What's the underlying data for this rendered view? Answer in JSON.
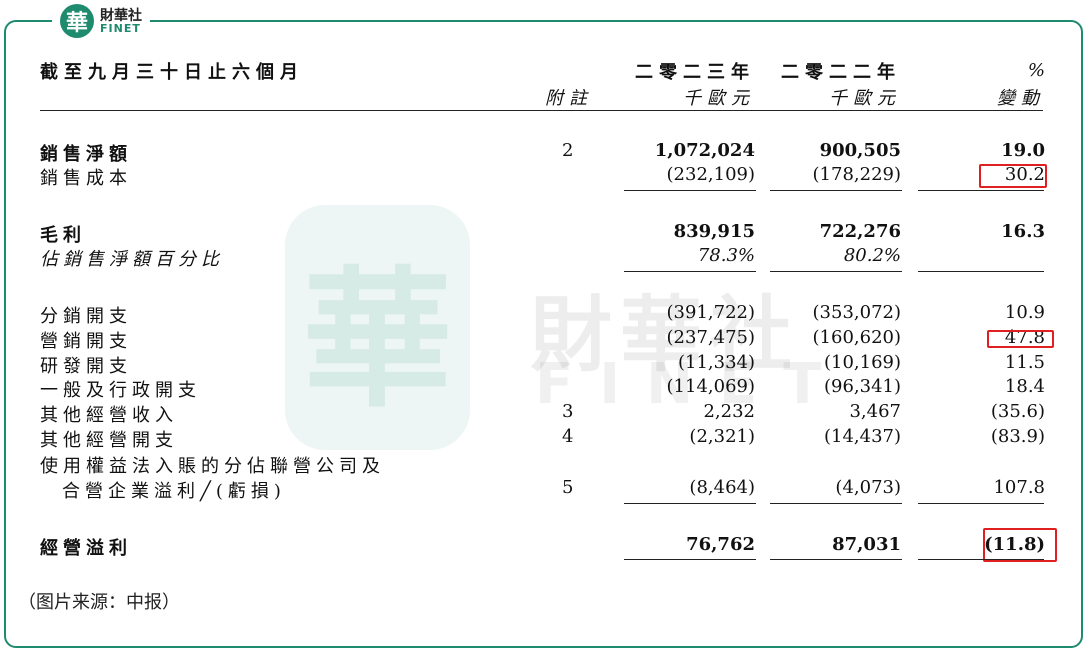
{
  "brand": {
    "logo_char": "華",
    "name_cn": "財華社",
    "name_en": "FINET"
  },
  "watermark": {
    "seal_char": "華",
    "text_cn": "財華社",
    "text_en": "FINET"
  },
  "header": {
    "period": "截至九月三十日止六個月",
    "note_col": "附註",
    "col_2023_year": "二零二三年",
    "col_2023_unit": "千歐元",
    "col_2022_year": "二零二二年",
    "col_2022_unit": "千歐元",
    "col_change_sym": "%",
    "col_change_label": "變動"
  },
  "rows": {
    "net_sales": {
      "label": "銷售淨額",
      "note": "2",
      "v2023": "1,072,024",
      "v2022": "900,505",
      "change": "19.0"
    },
    "cost_of_sales": {
      "label": "銷售成本",
      "v2023": "(232,109)",
      "v2022": "(178,229)",
      "change": "30.2"
    },
    "gross_profit": {
      "label": "毛利",
      "v2023": "839,915",
      "v2022": "722,276",
      "change": "16.3"
    },
    "gross_margin": {
      "label": "佔銷售淨額百分比",
      "v2023": "78.3%",
      "v2022": "80.2%"
    },
    "distribution": {
      "label": "分銷開支",
      "v2023": "(391,722)",
      "v2022": "(353,072)",
      "change": "10.9"
    },
    "marketing": {
      "label": "營銷開支",
      "v2023": "(237,475)",
      "v2022": "(160,620)",
      "change": "47.8"
    },
    "rnd": {
      "label": "研發開支",
      "v2023": "(11,334)",
      "v2022": "(10,169)",
      "change": "11.5"
    },
    "ga": {
      "label": "一般及行政開支",
      "v2023": "(114,069)",
      "v2022": "(96,341)",
      "change": "18.4"
    },
    "other_income": {
      "label": "其他經營收入",
      "note": "3",
      "v2023": "2,232",
      "v2022": "3,467",
      "change": "(35.6)"
    },
    "other_expense": {
      "label": "其他經營開支",
      "note": "4",
      "v2023": "(2,321)",
      "v2022": "(14,437)",
      "change": "(83.9)"
    },
    "equity_share_line1": {
      "label": "使用權益法入賬的分佔聯營公司及"
    },
    "equity_share": {
      "label": "合營企業溢利╱(虧損)",
      "note": "5",
      "v2023": "(8,464)",
      "v2022": "(4,073)",
      "change": "107.8"
    },
    "operating_profit": {
      "label": "經營溢利",
      "v2023": "76,762",
      "v2022": "87,031",
      "change": "(11.8)"
    }
  },
  "footer": {
    "source": "（图片来源：中报）"
  },
  "colors": {
    "frame": "#1e8a6e",
    "highlight": "#e02020"
  }
}
